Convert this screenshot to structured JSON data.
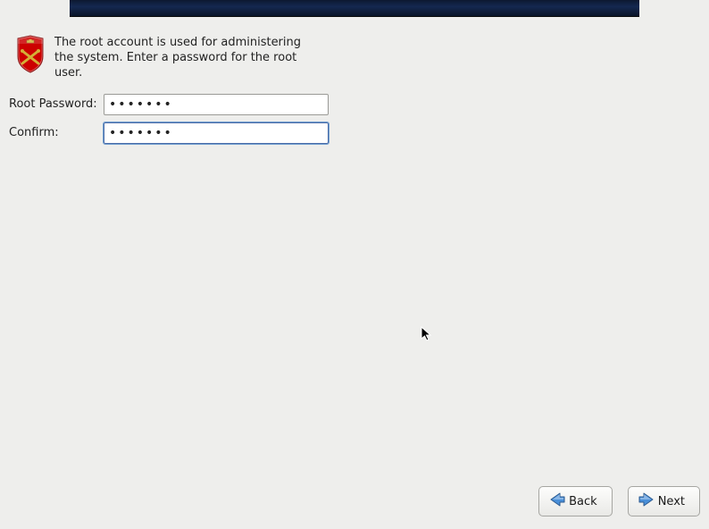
{
  "info_text": "The root account is used for administering the system.  Enter a password for the root user.",
  "labels": {
    "root_password": "Root Password:",
    "confirm": "Confirm:"
  },
  "inputs": {
    "root_password_value": "•••••••",
    "confirm_value": "•••••••"
  },
  "buttons": {
    "back": "Back",
    "next": "Next"
  },
  "colors": {
    "banner_bg": "#142850",
    "button_bg": "#f0f0ed",
    "arrow_blue": "#4a90d9"
  },
  "icon_names": {
    "shield": "root-shield-icon",
    "back_arrow": "arrow-left-icon",
    "next_arrow": "arrow-right-icon"
  }
}
